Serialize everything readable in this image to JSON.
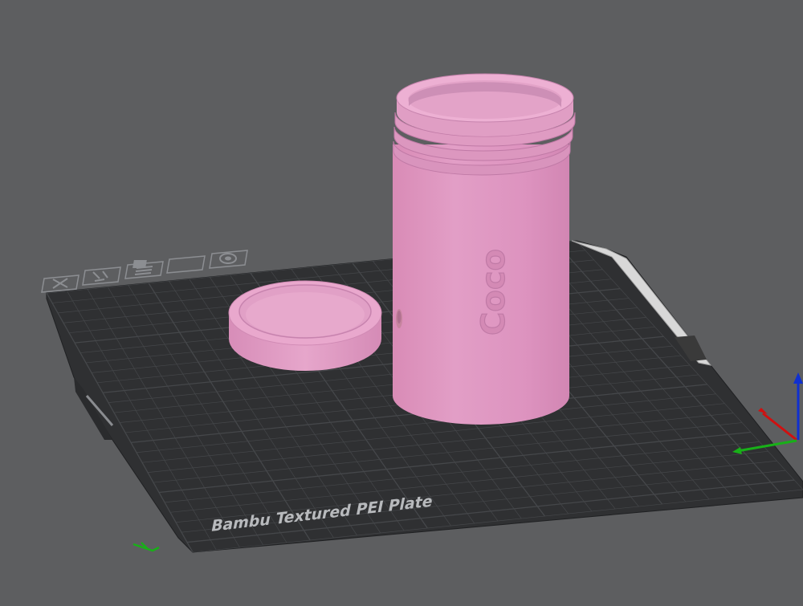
{
  "scene": {
    "background_color": "#5d5e60",
    "plate": {
      "label": "Bambu Textured PEI Plate",
      "surface_color": "#2f3032",
      "grid_color": "#45474a",
      "icons": [
        "close-icon",
        "arrange-icon",
        "list-icon",
        "box-icon",
        "target-icon"
      ]
    },
    "objects": [
      {
        "name": "jar",
        "color": "#e19bc4",
        "text": "Coco"
      },
      {
        "name": "lid",
        "color": "#e19bc4"
      }
    ],
    "axes": {
      "x_color": "#d01010",
      "y_color": "#18b018",
      "z_color": "#1030d0"
    }
  }
}
